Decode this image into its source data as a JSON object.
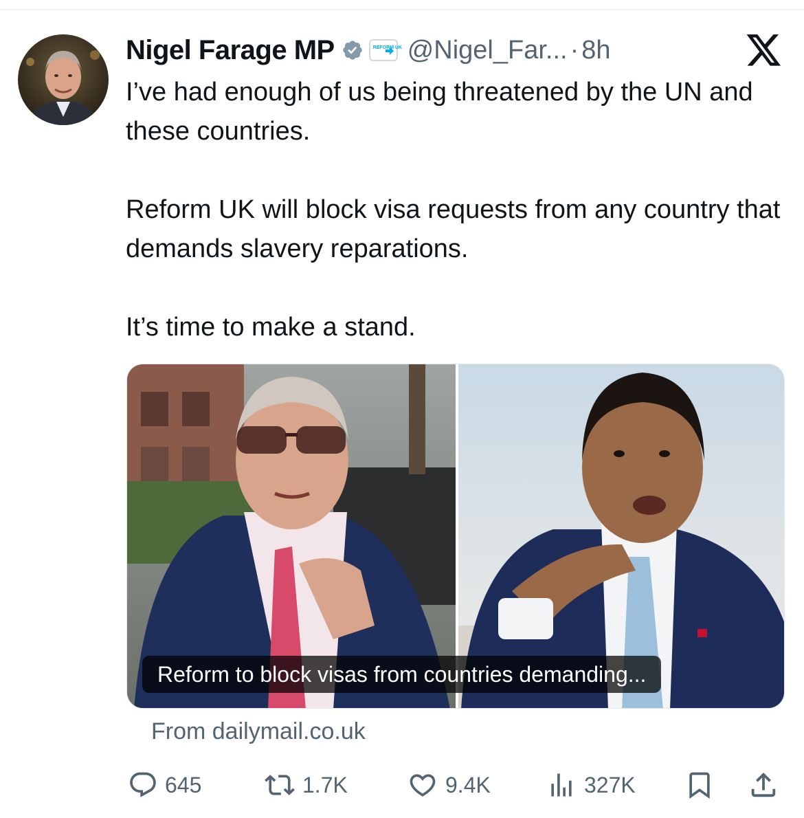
{
  "author": {
    "display_name": "Nigel Farage MP",
    "handle": "@Nigel_Far...",
    "separator": "·",
    "time": "8h",
    "affiliate_badge": "REFORM UK",
    "verified_color": "#829aab"
  },
  "tweet": {
    "paragraphs": [
      "I’ve had enough of us being threatened by the UN and these countries.",
      "Reform UK will block visa requests from any country that demands slavery reparations.",
      "It’s time to make a stand."
    ]
  },
  "media": {
    "caption": "Reform to block visas from countries demanding...",
    "source": "From dailymail.co.uk"
  },
  "actions": {
    "replies": "645",
    "reposts": "1.7K",
    "likes": "9.4K",
    "views": "327K"
  },
  "icons": [
    "verified-badge-icon",
    "reform-uk-badge-icon",
    "x-logo-icon",
    "reply-icon",
    "repost-icon",
    "like-icon",
    "views-icon",
    "bookmark-icon",
    "share-icon"
  ],
  "colors": {
    "text": "#0f1419",
    "secondary": "#536471",
    "accent": "#1d9bf0"
  }
}
